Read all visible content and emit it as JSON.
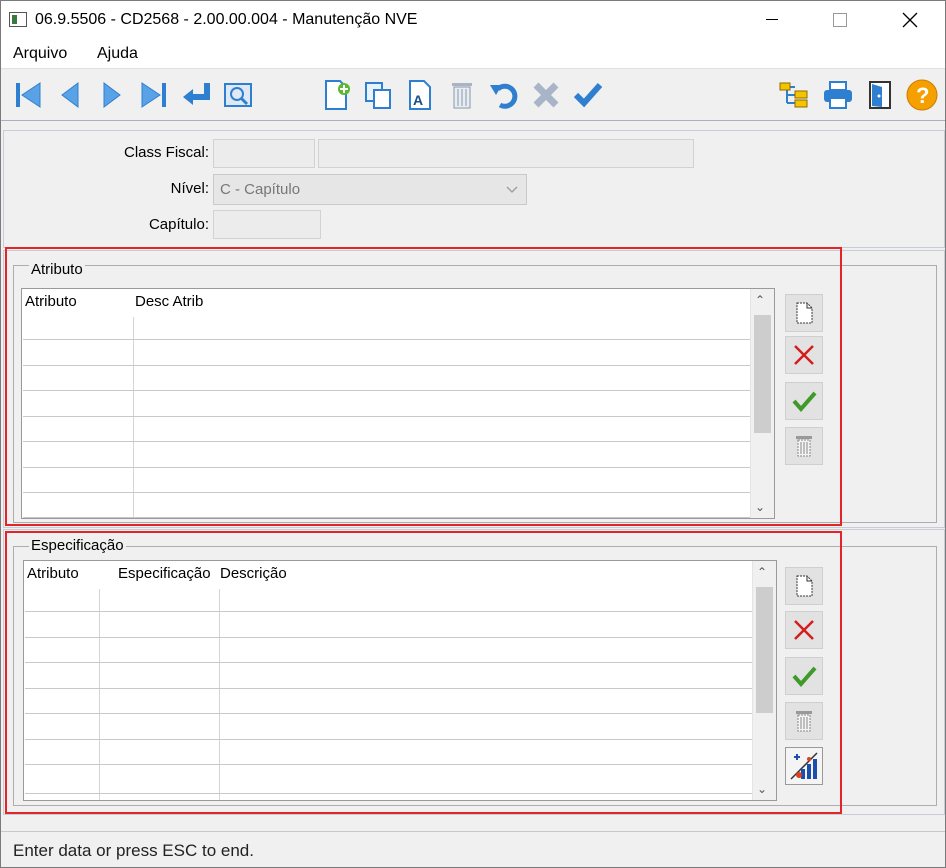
{
  "window": {
    "title": "06.9.5506 - CD2568 - 2.00.00.004 - Manutenção NVE"
  },
  "menu": {
    "items": [
      "Arquivo",
      "Ajuda"
    ]
  },
  "toolbar": {
    "icons": [
      "first-record-icon",
      "previous-record-icon",
      "next-record-icon",
      "last-record-icon",
      "return-icon",
      "preview-icon",
      "new-record-icon",
      "copy-icon",
      "edit-text-icon",
      "delete-icon",
      "undo-icon",
      "cancel-icon",
      "confirm-icon",
      "tree-icon",
      "print-icon",
      "exit-icon",
      "help-icon"
    ]
  },
  "form": {
    "class_fiscal_label": "Class Fiscal:",
    "class_fiscal_code": "",
    "class_fiscal_desc": "",
    "nivel_label": "Nível:",
    "nivel_value": "C - Capítulo",
    "capitulo_label": "Capítulo:",
    "capitulo_value": ""
  },
  "atributo_group": {
    "title": "Atributo",
    "columns": [
      "Atributo",
      "Desc Atrib"
    ]
  },
  "especificacao_group": {
    "title": "Especificação",
    "columns": [
      "Atributo",
      "Especificação",
      "Descrição"
    ]
  },
  "status": {
    "message": "Enter data or press ESC to end."
  },
  "colors": {
    "highlight_frame": "#e32428",
    "toolbar_blue": "#2f7fd0",
    "help_orange": "#f5a000"
  }
}
